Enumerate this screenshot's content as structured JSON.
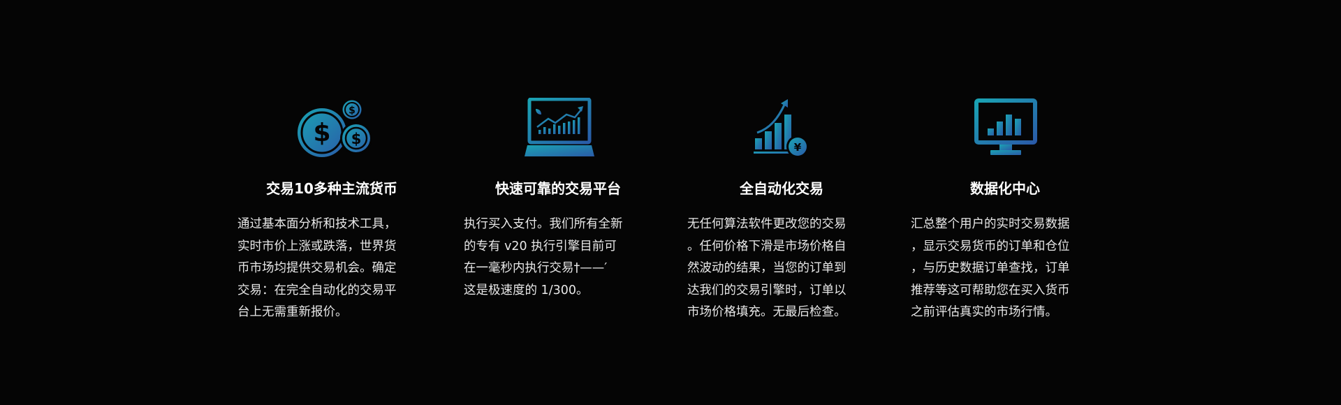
{
  "features": [
    {
      "icon": "dollar-coins-icon",
      "title": "交易10多种主流货币",
      "lines": [
        "通过基本面分析和技术工具，",
        "实时市价上涨或跌落，世界货",
        "币市场均提供交易机会。确定",
        "交易：在完全自动化的交易平",
        "台上无需重新报价。"
      ]
    },
    {
      "icon": "trading-monitor-icon",
      "title": "快速可靠的交易平台",
      "lines": [
        "执行买入支付。我们所有全新",
        "的专有 v20 执行引擎目前可",
        "在一毫秒内执行交易†——′",
        "这是极速度的 1/300。"
      ]
    },
    {
      "icon": "growth-chart-yen-icon",
      "title": "全自动化交易",
      "lines": [
        "无任何算法软件更改您的交易",
        "。任何价格下滑是市场价格自",
        "然波动的结果，当您的订单到",
        "达我们的交易引擎时，订单以",
        "市场价格填充。无最后检查。"
      ]
    },
    {
      "icon": "data-monitor-icon",
      "title": "数据化中心",
      "lines": [
        "汇总整个用户的实时交易数据",
        "，显示交易货币的订单和仓位",
        "，与历史数据订单查找，订单",
        "推荐等这可帮助您在买入货币",
        "之前评估真实的市场行情。"
      ]
    }
  ],
  "colors": {
    "background": "#050505",
    "icon_gradient_start": "#1a9bb0",
    "icon_gradient_end": "#2a5ba8",
    "text": "#ffffff"
  }
}
